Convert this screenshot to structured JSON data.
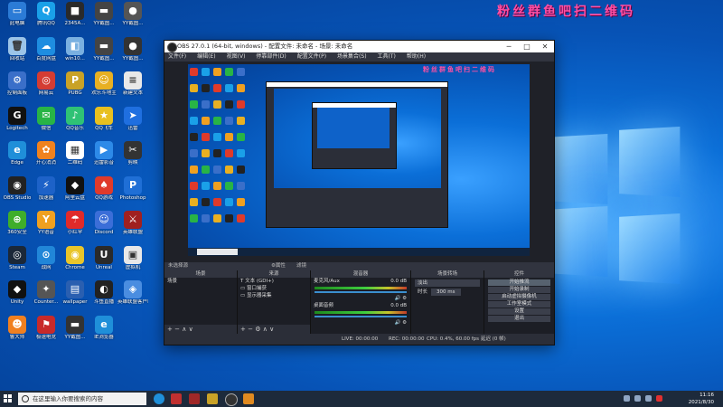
{
  "watermark": "粉丝群鱼吧扫二维码",
  "desktop_icons": [
    {
      "label": "此电脑",
      "color": "#2b7bd6",
      "glyph": "▭"
    },
    {
      "label": "腾讯QQ",
      "color": "#1aa0e8",
      "glyph": "Q"
    },
    {
      "label": "2345A...",
      "color": "#2a2a2a",
      "glyph": "■"
    },
    {
      "label": "YY截图...",
      "color": "#444",
      "glyph": "▬"
    },
    {
      "label": "YY截图...",
      "color": "#555",
      "glyph": "●"
    },
    {
      "label": "回收站",
      "color": "#9bc4e8",
      "glyph": "🗑"
    },
    {
      "label": "百度网盘",
      "color": "#1e8de0",
      "glyph": "☁"
    },
    {
      "label": "win10...",
      "color": "#7ab0e0",
      "glyph": "◧"
    },
    {
      "label": "YY截图...",
      "color": "#444",
      "glyph": "▬"
    },
    {
      "label": "YY截图...",
      "color": "#333",
      "glyph": "●"
    },
    {
      "label": "控制面板",
      "color": "#3a6fc9",
      "glyph": "⚙"
    },
    {
      "label": "网易云",
      "color": "#d43c33",
      "glyph": "◎"
    },
    {
      "label": "PUBG",
      "color": "#c9a227",
      "glyph": "P"
    },
    {
      "label": "欢乐斗地主",
      "color": "#e8b022",
      "glyph": "☺"
    },
    {
      "label": "新建文本",
      "color": "#e8e8e8",
      "glyph": "≡"
    },
    {
      "label": "Logitech",
      "color": "#111",
      "glyph": "G"
    },
    {
      "label": "微信",
      "color": "#28b446",
      "glyph": "✉"
    },
    {
      "label": "QQ音乐",
      "color": "#2fc275",
      "glyph": "♪"
    },
    {
      "label": "QQ飞车",
      "color": "#e8c020",
      "glyph": "★"
    },
    {
      "label": "迅雷",
      "color": "#1f6fe0",
      "glyph": "➤"
    },
    {
      "label": "Edge",
      "color": "#1f8fd9",
      "glyph": "e"
    },
    {
      "label": "开心消消",
      "color": "#f0821e",
      "glyph": "✿"
    },
    {
      "label": "二维码",
      "color": "#ffffff",
      "glyph": "▦"
    },
    {
      "label": "迅雷影音",
      "color": "#2d8ae8",
      "glyph": "▶"
    },
    {
      "label": "剪映",
      "color": "#333",
      "glyph": "✂"
    },
    {
      "label": "OBS Studio",
      "color": "#222",
      "glyph": "◉"
    },
    {
      "label": "加速器",
      "color": "#1d62c8",
      "glyph": "⚡"
    },
    {
      "label": "阿里云盘",
      "color": "#111",
      "glyph": "◆"
    },
    {
      "label": "QQ游戏",
      "color": "#e03a2a",
      "glyph": "♠"
    },
    {
      "label": "Photoshop",
      "color": "#1f6fd6",
      "glyph": "P"
    },
    {
      "label": "360安全",
      "color": "#3fae2a",
      "glyph": "⊕"
    },
    {
      "label": "YY语音",
      "color": "#f0a020",
      "glyph": "Y"
    },
    {
      "label": "小红伞",
      "color": "#e02a2a",
      "glyph": "☂"
    },
    {
      "label": "Discord",
      "color": "#3b6ed8",
      "glyph": "☺"
    },
    {
      "label": "英雄联盟",
      "color": "#a02020",
      "glyph": "⚔"
    },
    {
      "label": "Steam",
      "color": "#1b2838",
      "glyph": "◎"
    },
    {
      "label": "战网",
      "color": "#2186d8",
      "glyph": "⊙"
    },
    {
      "label": "Chrome",
      "color": "#e9c52a",
      "glyph": "◉"
    },
    {
      "label": "Unreal",
      "color": "#2a2a2a",
      "glyph": "U"
    },
    {
      "label": "虚拟机",
      "color": "#e8e8e8",
      "glyph": "▣"
    },
    {
      "label": "Unity",
      "color": "#111",
      "glyph": "◆"
    },
    {
      "label": "Counter...",
      "color": "#555",
      "glyph": "✦"
    },
    {
      "label": "wallpaper",
      "color": "#2a5fb0",
      "glyph": "▤"
    },
    {
      "label": "斗鱼直播",
      "color": "#222",
      "glyph": "◐"
    },
    {
      "label": "英雄联盟客户端",
      "color": "#4a8de0",
      "glyph": "◈"
    },
    {
      "label": "鲁大师",
      "color": "#f08020",
      "glyph": "☻"
    },
    {
      "label": "极速电竞",
      "color": "#c82a2a",
      "glyph": "⚑"
    },
    {
      "label": "YY截图...",
      "color": "#333",
      "glyph": "▬"
    },
    {
      "label": "IE浏览器",
      "color": "#1f8fd9",
      "glyph": "e"
    }
  ],
  "obs": {
    "title": "OBS 27.0.1 (64-bit, windows) - 配置文件: 未命名 - 场景: 未命名",
    "menu": [
      "文件(F)",
      "编辑(E)",
      "视图(V)",
      "停靠部件(D)",
      "配置文件(P)",
      "场景集合(S)",
      "工具(T)",
      "帮助(H)"
    ],
    "toolbar_left": "未选择源",
    "toolbar_props": "⚙属性",
    "toolbar_filters": "滤镜",
    "docks": {
      "scenes": {
        "title": "场景",
        "items": [
          "场景"
        ]
      },
      "sources": {
        "title": "来源",
        "items": [
          "T 文本 (GDI+)",
          "▭ 窗口捕获",
          "▭ 显示器采集"
        ]
      },
      "mixer": {
        "title": "混音器",
        "channels": [
          {
            "name": "麦克风/Aux",
            "db": "0.0 dB"
          },
          {
            "name": "桌面音频",
            "db": "0.0 dB"
          }
        ]
      },
      "transitions": {
        "title": "场景转场",
        "type": "淡出",
        "duration_label": "时长",
        "duration": "300 ms"
      },
      "controls": {
        "title": "控件",
        "buttons": [
          "开始推流",
          "开始录制",
          "启动虚拟摄像机",
          "工作室模式",
          "设置",
          "退出"
        ]
      }
    },
    "status": {
      "live": "LIVE: 00:00:00",
      "rec": "REC: 00:00:00",
      "cpu": "CPU: 0.4%, 60.00 fps",
      "dropped": "延迟 (0 帧)"
    }
  },
  "taskbar": {
    "search_placeholder": "在这里输入你要搜索的内容",
    "time": "11:16",
    "date": "2021/8/30"
  }
}
